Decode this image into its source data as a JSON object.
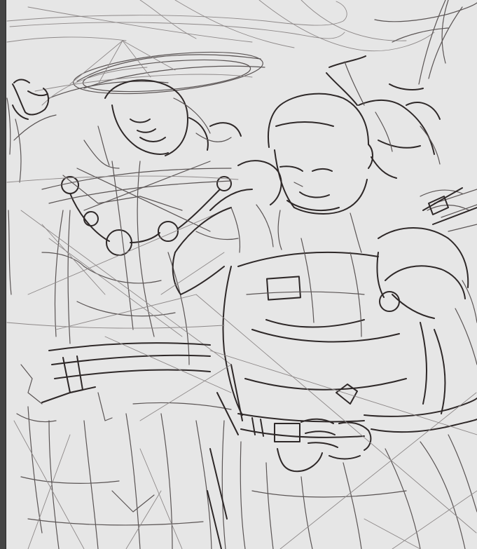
{
  "app": {
    "canvas": {
      "background": "#e6e6e6",
      "stroke_color": "#3a3434",
      "content": "sketch-drawing"
    },
    "side_panel": {
      "background": "#454545"
    }
  }
}
